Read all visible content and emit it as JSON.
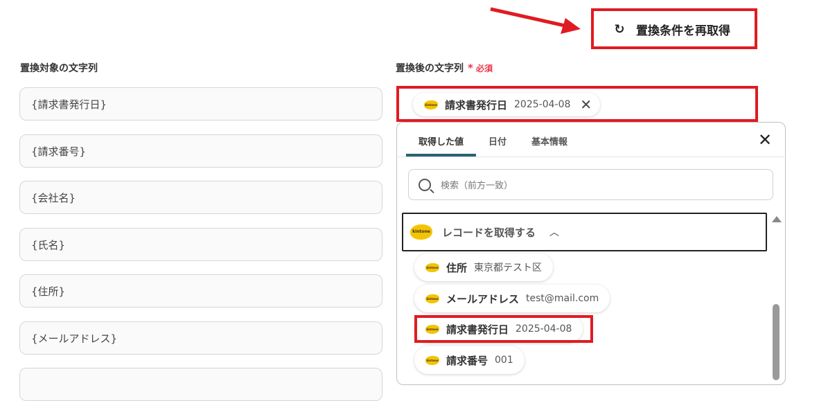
{
  "header": {
    "refetch_label": "置換条件を再取得"
  },
  "left": {
    "label": "置換対象の文字列",
    "fields": [
      "{請求書発行日}",
      "{請求番号}",
      "{会社名}",
      "{氏名}",
      "{住所}",
      "{メールアドレス}"
    ]
  },
  "right": {
    "label": "置換後の文字列",
    "required": "必須",
    "selected": {
      "name": "請求書発行日",
      "value": "2025-04-08",
      "icon": "kintone"
    }
  },
  "dropdown": {
    "tabs": [
      "取得した値",
      "日付",
      "基本情報"
    ],
    "search_placeholder": "検索（前方一致）",
    "group_title": "レコードを取得する",
    "items": [
      {
        "name": "住所",
        "value": "東京都テスト区"
      },
      {
        "name": "メールアドレス",
        "value": "test@mail.com"
      },
      {
        "name": "請求書発行日",
        "value": "2025-04-08"
      },
      {
        "name": "請求番号",
        "value": "001"
      }
    ]
  },
  "colors": {
    "highlight": "#e01b22",
    "active_tab": "#2a6272",
    "required": "#e8374a",
    "kintone": "#f5c300"
  }
}
